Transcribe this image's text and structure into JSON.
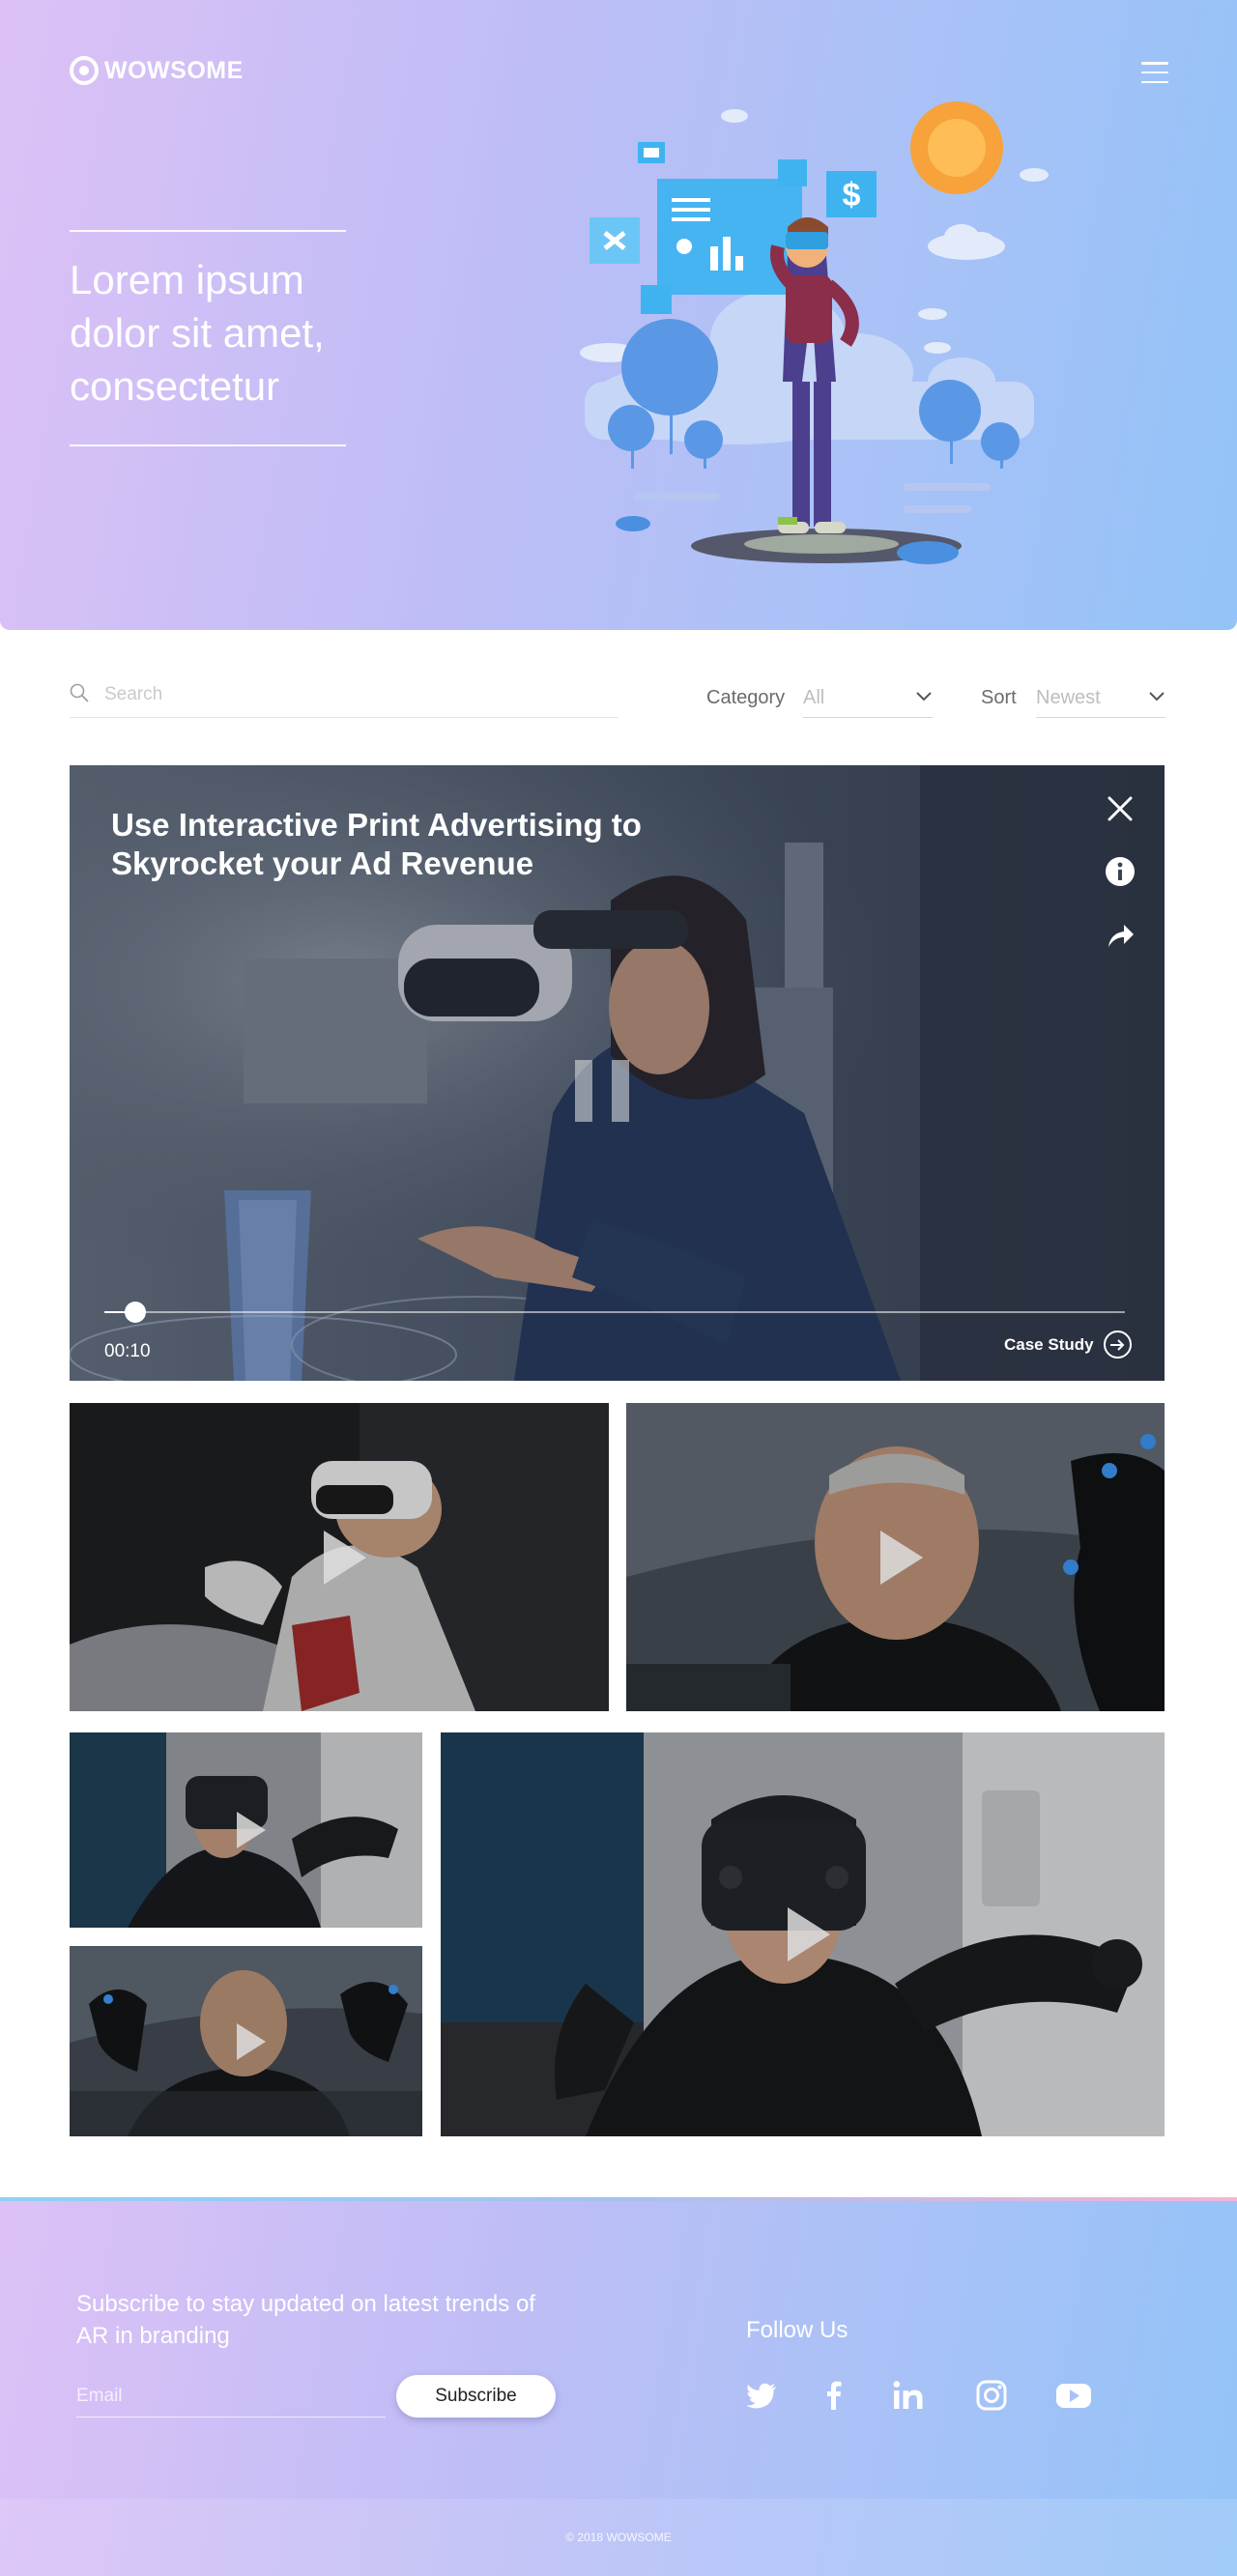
{
  "brand": {
    "name": "WOWSOME"
  },
  "hero": {
    "title": "Lorem ipsum dolor sit amet, consectetur"
  },
  "filters": {
    "search_placeholder": "Search",
    "category_label": "Category",
    "category_value": "All",
    "sort_label": "Sort",
    "sort_value": "Newest"
  },
  "featured": {
    "title": "Use Interactive Print Advertising to Skyrocket your Ad Revenue",
    "timecode": "00:10",
    "progress": 0.03,
    "cta": "Case Study"
  },
  "footer": {
    "subscribe_text": "Subscribe to stay updated on latest trends of AR in branding",
    "email_placeholder": "Email",
    "subscribe_button": "Subscribe",
    "follow_label": "Follow Us",
    "social": [
      "twitter-icon",
      "facebook-icon",
      "linkedin-icon",
      "instagram-icon",
      "youtube-icon"
    ],
    "copyright": "© 2018 WOWSOME"
  },
  "colors": {
    "gradient_start": "#dcc1f6",
    "gradient_end": "#93c3f8",
    "hero_sun": "#f7a23a",
    "screen_blue": "#3fb3f0"
  }
}
